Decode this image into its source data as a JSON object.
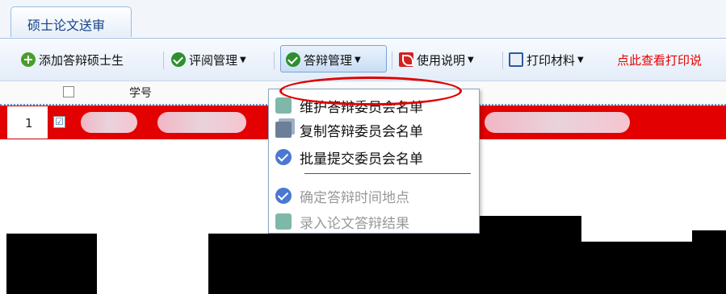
{
  "tab": {
    "label": "硕士论文送审"
  },
  "toolbar": {
    "add_button": "添加答辩硕士生",
    "review_button": "评阅管理",
    "defense_button": "答辩管理",
    "manual_button": "使用说明",
    "print_button": "打印材料",
    "print_link": "点此查看打印说"
  },
  "grid": {
    "header": {
      "col_no": "学号"
    },
    "row": {
      "number": "1",
      "checked": "☑"
    }
  },
  "menu": {
    "items": [
      {
        "label": "维护答辩委员会名单",
        "icon": "edit-icon"
      },
      {
        "label": "复制答辩委员会名单",
        "icon": "copy-icon"
      },
      {
        "label": "批量提交委员会名单",
        "icon": "check-icon"
      },
      {
        "label": "确定答辩时间地点",
        "icon": "check-icon"
      },
      {
        "label": "录入论文答辩结果",
        "icon": "edit-icon"
      }
    ]
  },
  "colors": {
    "accent": "#15428b",
    "highlight_row": "#e20000",
    "link": "#e60000"
  }
}
